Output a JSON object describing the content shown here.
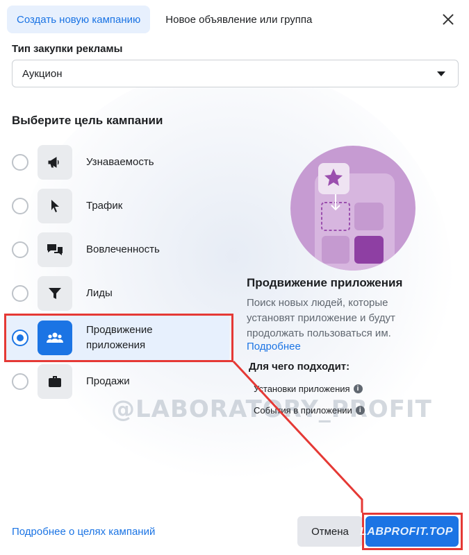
{
  "tabs": {
    "create_campaign": "Создать новую кампанию",
    "new_ad_or_group": "Новое объявление или группа"
  },
  "buy_type": {
    "label": "Тип закупки рекламы",
    "value": "Аукцион"
  },
  "objectives": {
    "heading": "Выберите цель кампании",
    "items": [
      {
        "label": "Узнаваемость",
        "icon": "megaphone-icon",
        "selected": false
      },
      {
        "label": "Трафик",
        "icon": "cursor-icon",
        "selected": false
      },
      {
        "label": "Вовлеченность",
        "icon": "chat-bubbles-icon",
        "selected": false
      },
      {
        "label": "Лиды",
        "icon": "funnel-icon",
        "selected": false
      },
      {
        "label": "Продвижение приложения",
        "icon": "people-icon",
        "selected": true
      },
      {
        "label": "Продажи",
        "icon": "briefcase-icon",
        "selected": false
      }
    ]
  },
  "info": {
    "title": "Продвижение приложения",
    "description": "Поиск новых людей, которые установят приложение и будут продолжать пользоваться им.",
    "more_link": "Подробнее",
    "suited_heading": "Для чего подходит:",
    "suited_items": [
      "Установки приложения",
      "События в приложении"
    ]
  },
  "footer": {
    "learn_more": "Подробнее о целях кампаний",
    "cancel": "Отмена",
    "overlay_label": "LABPROFIT.TOP"
  },
  "watermark": "@LABORATORY_PROFIT",
  "colors": {
    "accent": "#1b74e4",
    "highlight": "#e53935",
    "illustration": "#c69bd2"
  }
}
